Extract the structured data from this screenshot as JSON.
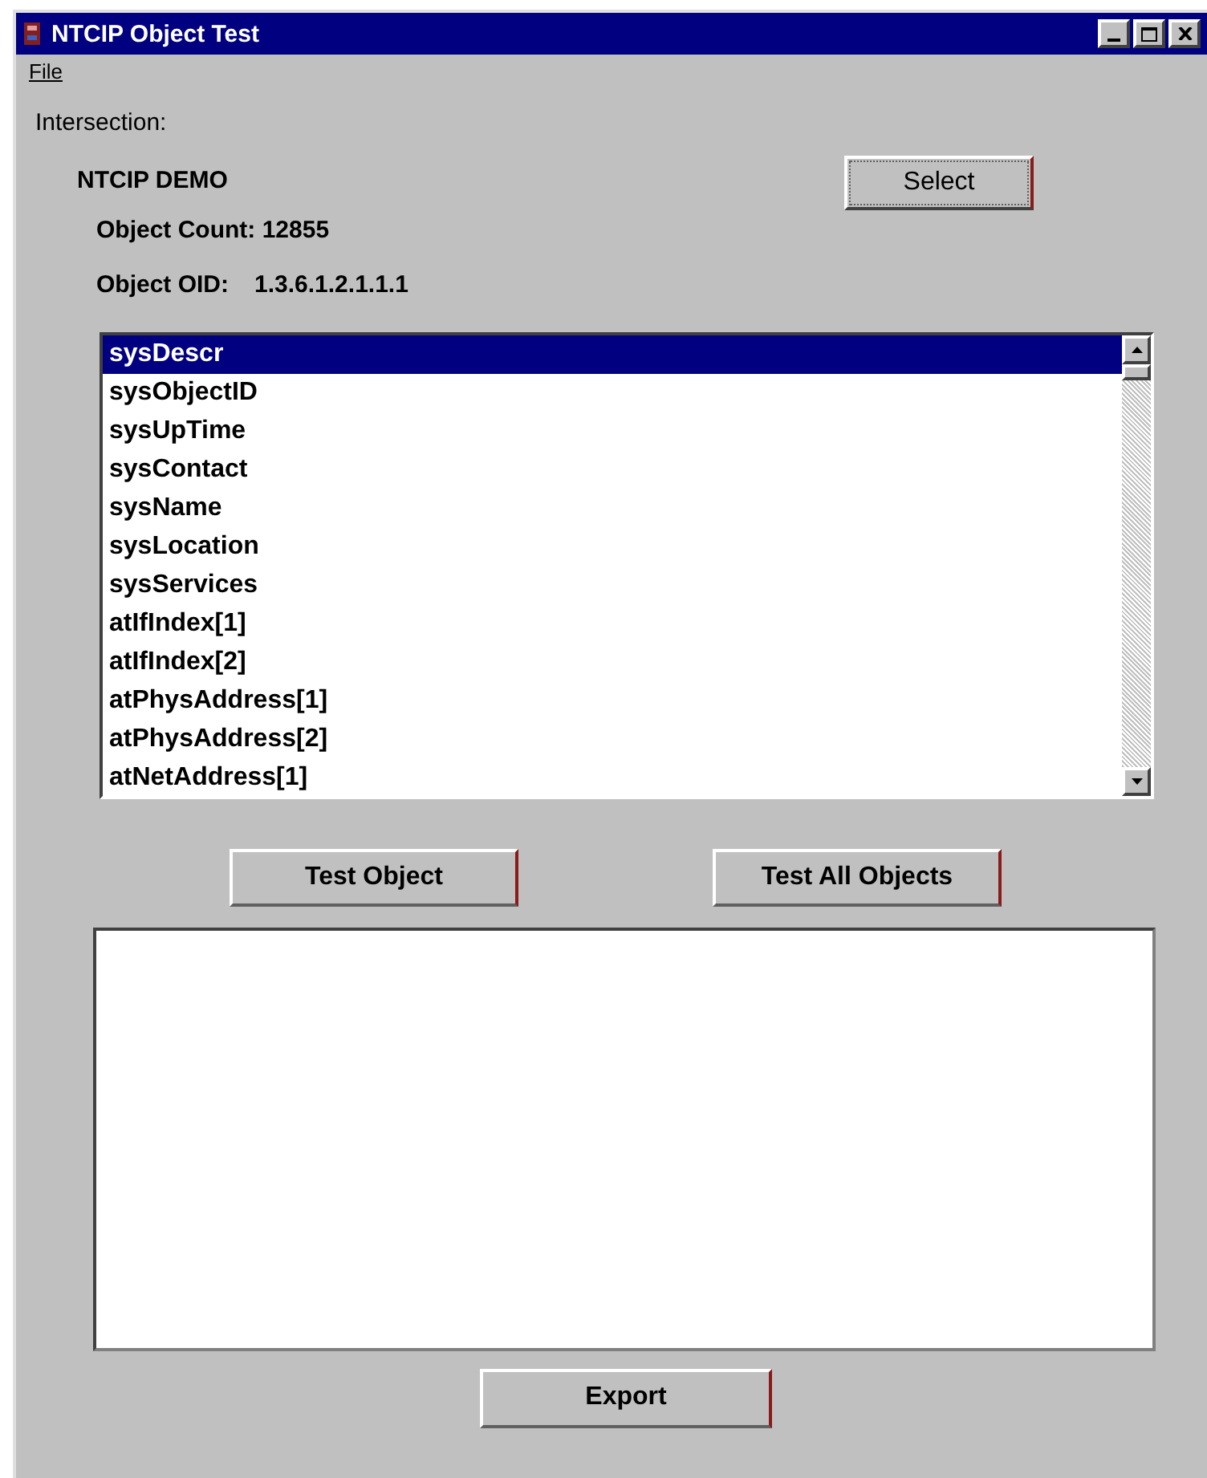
{
  "window": {
    "title": "NTCIP Object Test"
  },
  "menu": [
    "File"
  ],
  "intersection_label": "Intersection:",
  "intersection_name": "NTCIP DEMO",
  "select_button": "Select",
  "object_count": "Object Count: 12855",
  "object_oid_label": "Object OID:",
  "object_oid_value": "1.3.6.1.2.1.1.1",
  "objects": [
    {
      "label": "sysDescr",
      "selected": true
    },
    {
      "label": "sysObjectID",
      "selected": false
    },
    {
      "label": "sysUpTime",
      "selected": false
    },
    {
      "label": "sysContact",
      "selected": false
    },
    {
      "label": "sysName",
      "selected": false
    },
    {
      "label": "sysLocation",
      "selected": false
    },
    {
      "label": "sysServices",
      "selected": false
    },
    {
      "label": "atIfIndex[1]",
      "selected": false
    },
    {
      "label": "atIfIndex[2]",
      "selected": false
    },
    {
      "label": "atPhysAddress[1]",
      "selected": false
    },
    {
      "label": "atPhysAddress[2]",
      "selected": false
    },
    {
      "label": "atNetAddress[1]",
      "selected": false
    }
  ],
  "buttons": [
    "Test Object",
    "Test All Objects"
  ],
  "export_button": "Export"
}
